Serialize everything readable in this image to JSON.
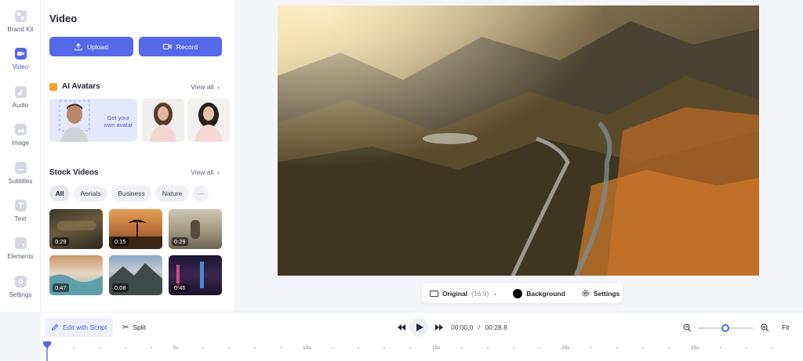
{
  "rail": {
    "items": [
      {
        "label": "Brand Kit",
        "icon": "brand-kit-icon"
      },
      {
        "label": "Video",
        "icon": "video-icon"
      },
      {
        "label": "Audio",
        "icon": "audio-icon"
      },
      {
        "label": "Image",
        "icon": "image-icon"
      },
      {
        "label": "Subtitles",
        "icon": "subtitles-icon"
      },
      {
        "label": "Text",
        "icon": "text-icon"
      },
      {
        "label": "Elements",
        "icon": "elements-icon"
      },
      {
        "label": "Settings",
        "icon": "settings-icon"
      }
    ],
    "active": "Video"
  },
  "panel": {
    "title": "Video",
    "upload_label": "Upload",
    "record_label": "Record",
    "ai_avatars": {
      "title": "AI Avatars",
      "view_all": "View all",
      "create_card_text": "Get your own avatar"
    },
    "stock_videos": {
      "title": "Stock Videos",
      "view_all": "View all",
      "filters": [
        "All",
        "Aerials",
        "Business",
        "Nature",
        "···"
      ],
      "active_filter": "All",
      "thumbnails": [
        {
          "duration": "0:29"
        },
        {
          "duration": "0:15"
        },
        {
          "duration": "0:29"
        },
        {
          "duration": "0:47"
        },
        {
          "duration": "0:08"
        },
        {
          "duration": "0:46"
        }
      ]
    }
  },
  "canvas_toolbar": {
    "aspect_label": "Original",
    "aspect_ratio": "(16:9)",
    "background_label": "Background",
    "settings_label": "Settings"
  },
  "playback": {
    "edit_with_script": "Edit with Script",
    "split": "Split",
    "current_time": "00:00.0",
    "separator": "/",
    "total_time": "00:28.8",
    "zoom_level": 0.5,
    "fit_label": "Fit"
  },
  "timeline": {
    "marks": [
      "5s",
      "10s",
      "15s",
      "20s",
      "25s"
    ]
  },
  "colors": {
    "accent": "#5468e8",
    "accent_light": "#eef0fd",
    "ai_badge": "#f5a623"
  }
}
